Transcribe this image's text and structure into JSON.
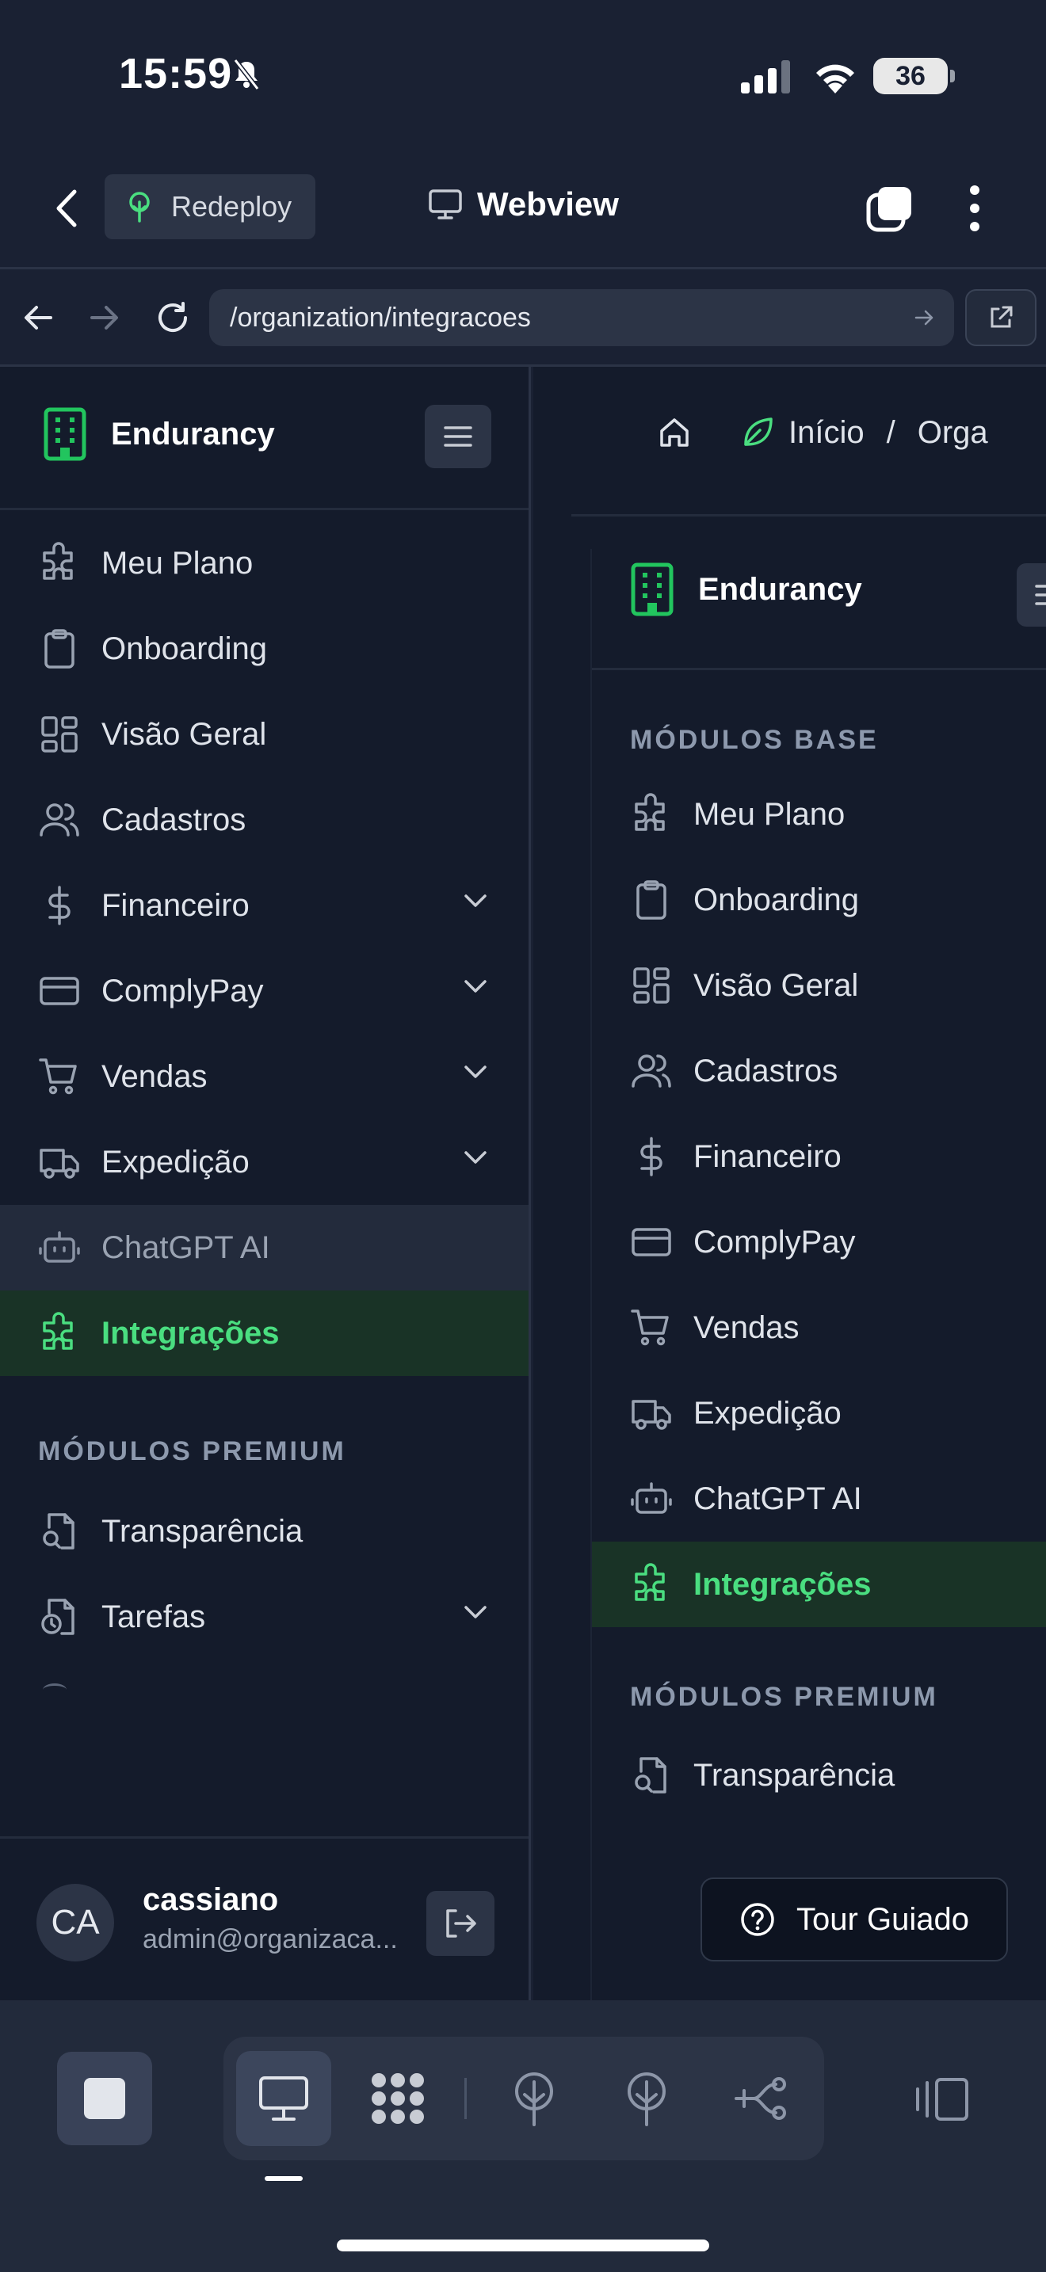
{
  "status_bar": {
    "time": "15:59",
    "battery": "36"
  },
  "app_header": {
    "chip_label": "Redeploy",
    "title": "Webview"
  },
  "url_bar": {
    "url": "/organization/integracoes"
  },
  "sidebar": {
    "brand": "Endurancy",
    "items": [
      {
        "label": "Meu Plano",
        "icon": "puzzle-icon"
      },
      {
        "label": "Onboarding",
        "icon": "clipboard-icon"
      },
      {
        "label": "Visão Geral",
        "icon": "dashboard-icon"
      },
      {
        "label": "Cadastros",
        "icon": "users-icon"
      },
      {
        "label": "Financeiro",
        "icon": "dollar-icon"
      },
      {
        "label": "ComplyPay",
        "icon": "credit-card-icon"
      },
      {
        "label": "Vendas",
        "icon": "cart-icon"
      },
      {
        "label": "Expedição",
        "icon": "truck-icon"
      },
      {
        "label": "ChatGPT AI",
        "icon": "bot-icon"
      },
      {
        "label": "Integrações",
        "icon": "puzzle-icon"
      }
    ],
    "premium_label": "MÓDULOS PREMIUM",
    "premium_items": [
      {
        "label": "Transparência",
        "icon": "file-search-icon"
      },
      {
        "label": "Tarefas",
        "icon": "file-clock-icon"
      }
    ],
    "user": {
      "initials": "CA",
      "name": "cassiano",
      "email": "admin@organizaca..."
    }
  },
  "content": {
    "breadcrumb": {
      "home": "Início",
      "separator": "/",
      "current": "Orga"
    },
    "brand": "Endurancy",
    "base_label": "MÓDULOS BASE",
    "items": [
      {
        "label": "Meu Plano"
      },
      {
        "label": "Onboarding"
      },
      {
        "label": "Visão Geral"
      },
      {
        "label": "Cadastros"
      },
      {
        "label": "Financeiro"
      },
      {
        "label": "ComplyPay"
      },
      {
        "label": "Vendas"
      },
      {
        "label": "Expedição"
      },
      {
        "label": "ChatGPT AI"
      },
      {
        "label": "Integrações"
      }
    ],
    "premium_label": "MÓDULOS PREMIUM",
    "premium_items": [
      {
        "label": "Transparência"
      }
    ],
    "tour_button": "Tour Guiado"
  },
  "colors": {
    "accent": "#4ade80",
    "background": "#141b2b",
    "active_bg": "#193326"
  }
}
